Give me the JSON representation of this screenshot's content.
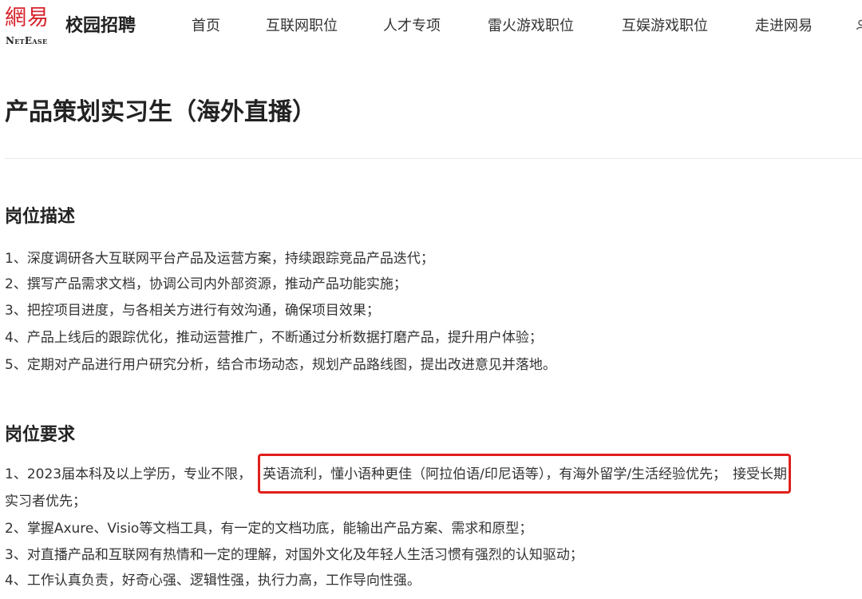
{
  "header": {
    "logo_cn": "網易",
    "logo_en": "NetEase",
    "site_title": "校园招聘",
    "nav": [
      "首页",
      "互联网职位",
      "人才专项",
      "雷火游戏职位",
      "互娱游戏职位",
      "走进网易"
    ]
  },
  "job": {
    "title": "产品策划实习生（海外直播）"
  },
  "description": {
    "heading": "岗位描述",
    "items": [
      "1、深度调研各大互联网平台产品及运营方案，持续跟踪竞品产品迭代；",
      "2、撰写产品需求文档，协调公司内外部资源，推动产品功能实施；",
      "3、把控项目进度，与各相关方进行有效沟通，确保项目效果；",
      "4、产品上线后的跟踪优化，推动运营推广，不断通过分析数据打磨产品，提升用户体验；",
      "5、定期对产品进行用户研究分析，结合市场动态，规划产品路线图，提出改进意见并落地。"
    ]
  },
  "requirements": {
    "heading": "岗位要求",
    "item1_part1": "1、2023届本科及以上学历，专业不限，",
    "item1_highlight": "英语流利，懂小语种更佳（阿拉伯语/印尼语等），有海外留学/生活经验优先；",
    "item1_part2": "接受长期",
    "item1_cont": "实习者优先；",
    "items": [
      "2、掌握Axure、Visio等文档工具，有一定的文档功底，能输出产品方案、需求和原型；",
      "3、对直播产品和互联网有热情和一定的理解，对国外文化及年轻人生活习惯有强烈的认知驱动；",
      "4、工作认真负责，好奇心强、逻辑性强，执行力高，工作导向性强。"
    ]
  },
  "colors": {
    "brand_red": "#d7232d",
    "highlight_border": "#e0201c"
  },
  "icons": {
    "nav_more": "user-icon"
  }
}
